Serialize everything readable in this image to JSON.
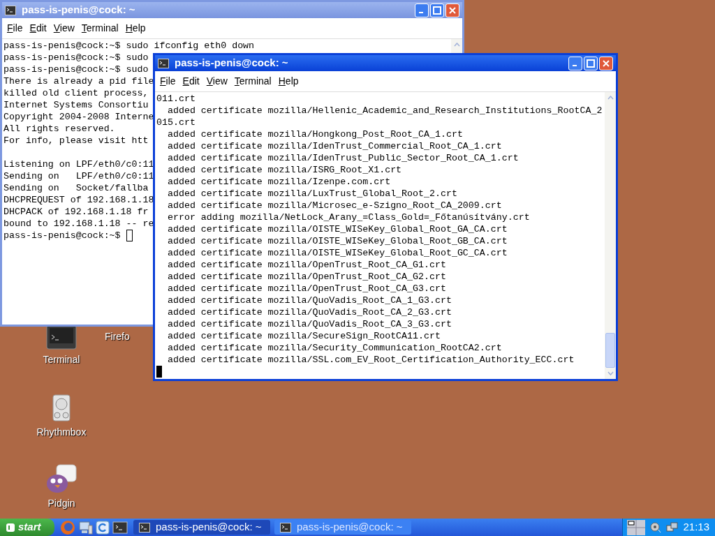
{
  "windows": [
    {
      "title": "pass-is-penis@cock: ~",
      "active": false,
      "menu": [
        "File",
        "Edit",
        "View",
        "Terminal",
        "Help"
      ],
      "blocks": [
        [
          {
            "text": "pass-is-penis@cock:~$ sudo ifconfig eth0 down"
          },
          {
            "text": "pass-is-penis@cock:~$ sudo"
          },
          {
            "text": "pass-is-penis@cock:~$ sudo"
          },
          {
            "text": "There is already a pid file"
          },
          {
            "text": "killed old client process,"
          },
          {
            "text": "Internet Systems Consortiu"
          },
          {
            "text": "Copyright 2004-2008 Interne"
          },
          {
            "text": "All rights reserved."
          },
          {
            "text": "For info, please visit htt"
          }
        ],
        [
          {
            "text": "Listening on LPF/eth0/c0:11"
          },
          {
            "text": "Sending on   LPF/eth0/c0:11"
          },
          {
            "text": "Sending on   Socket/fallba"
          },
          {
            "text": "DHCPREQUEST of 192.168.1.18"
          },
          {
            "text": "DHCPACK of 192.168.1.18 fr"
          },
          {
            "text": "bound to 192.168.1.18 -- re"
          },
          {
            "text": "pass-is-penis@cock:~$ ",
            "cursor": true
          }
        ]
      ]
    },
    {
      "title": "pass-is-penis@cock: ~",
      "active": true,
      "menu": [
        "File",
        "Edit",
        "View",
        "Terminal",
        "Help"
      ],
      "blocks": [
        [
          {
            "text": "011.crt"
          },
          {
            "text": "  added certificate mozilla/Hellenic_Academic_and_Research_Institutions_RootCA_2"
          },
          {
            "text": "015.crt"
          },
          {
            "text": "  added certificate mozilla/Hongkong_Post_Root_CA_1.crt"
          },
          {
            "text": "  added certificate mozilla/IdenTrust_Commercial_Root_CA_1.crt"
          },
          {
            "text": "  added certificate mozilla/IdenTrust_Public_Sector_Root_CA_1.crt"
          },
          {
            "text": "  added certificate mozilla/ISRG_Root_X1.crt"
          },
          {
            "text": "  added certificate mozilla/Izenpe.com.crt"
          },
          {
            "text": "  added certificate mozilla/LuxTrust_Global_Root_2.crt"
          },
          {
            "text": "  added certificate mozilla/Microsec_e-Szigno_Root_CA_2009.crt"
          },
          {
            "text": "  error adding mozilla/NetLock_Arany_=Class_Gold=_Főtanúsítvány.crt"
          },
          {
            "text": "  added certificate mozilla/OISTE_WISeKey_Global_Root_GA_CA.crt"
          },
          {
            "text": "  added certificate mozilla/OISTE_WISeKey_Global_Root_GB_CA.crt"
          },
          {
            "text": "  added certificate mozilla/OISTE_WISeKey_Global_Root_GC_CA.crt"
          },
          {
            "text": "  added certificate mozilla/OpenTrust_Root_CA_G1.crt"
          },
          {
            "text": "  added certificate mozilla/OpenTrust_Root_CA_G2.crt"
          },
          {
            "text": "  added certificate mozilla/OpenTrust_Root_CA_G3.crt"
          },
          {
            "text": "  added certificate mozilla/QuoVadis_Root_CA_1_G3.crt"
          },
          {
            "text": "  added certificate mozilla/QuoVadis_Root_CA_2_G3.crt"
          },
          {
            "text": "  added certificate mozilla/QuoVadis_Root_CA_3_G3.crt"
          },
          {
            "text": "  added certificate mozilla/SecureSign_RootCA11.crt"
          },
          {
            "text": "  added certificate mozilla/Security_Communication_RootCA2.crt"
          },
          {
            "text": "  added certificate mozilla/SSL.com_EV_Root_Certification_Authority_ECC.crt"
          },
          {
            "cursor": true
          }
        ]
      ]
    }
  ],
  "desktop_icons": [
    {
      "kind": "terminal",
      "label": "Terminal"
    },
    {
      "kind": "firefox",
      "label": "Firefo"
    },
    {
      "kind": "rhythmbox",
      "label": "Rhythmbox"
    },
    {
      "kind": "pidgin",
      "label": "Pidgin"
    }
  ],
  "taskbar": {
    "start": "start",
    "quick_launch": [
      {
        "kind": "firefox"
      },
      {
        "kind": "computer"
      },
      {
        "kind": "browser"
      },
      {
        "kind": "terminal"
      }
    ],
    "tasks": [
      {
        "label": "pass-is-penis@cock: ~",
        "selected": true
      },
      {
        "label": "pass-is-penis@cock: ~",
        "selected": false
      }
    ],
    "clock": "21:13"
  }
}
